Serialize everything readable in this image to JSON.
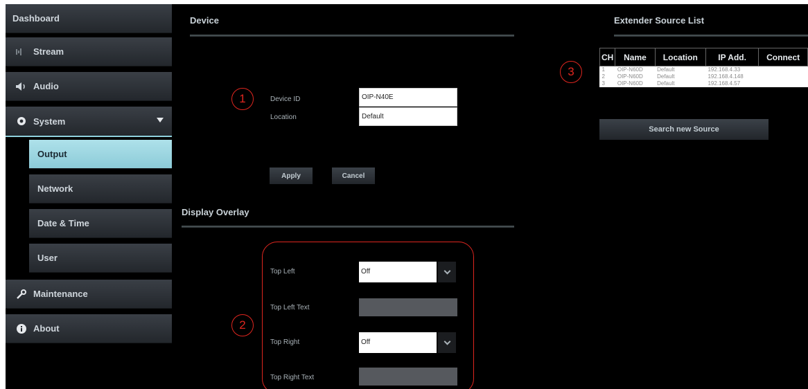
{
  "sidebar": {
    "dashboard": "Dashboard",
    "stream": "Stream",
    "audio": "Audio",
    "system": "System",
    "sub_items": [
      "Output",
      "Network",
      "Date & Time",
      "User"
    ],
    "maintenance": "Maintenance",
    "about": "About"
  },
  "device": {
    "title": "Device",
    "device_id_label": "Device ID",
    "device_id_value": "OIP-N40E",
    "location_label": "Location",
    "location_value": "Default",
    "apply_label": "Apply",
    "cancel_label": "Cancel"
  },
  "overlay": {
    "title": "Display Overlay",
    "top_left_label": "Top Left",
    "top_left_value": "Off",
    "top_left_text_label": "Top Left Text",
    "top_right_label": "Top Right",
    "top_right_value": "Off",
    "top_right_text_label": "Top Right Text"
  },
  "extender": {
    "title": "Extender Source List",
    "headers": [
      "CH",
      "Name",
      "Location",
      "IP Add.",
      "Connect"
    ],
    "rows": [
      [
        "1",
        "OIP-N60D",
        "Default",
        "192.168.4.33",
        ""
      ],
      [
        "2",
        "OIP-N60D",
        "Default",
        "192.168.4.148",
        ""
      ],
      [
        "3",
        "OIP-N60D",
        "Default",
        "192.168.4.57",
        ""
      ]
    ],
    "search_label": "Search new Source"
  },
  "callouts": [
    "1",
    "2",
    "3"
  ],
  "colors": {
    "active_item": "#9fd7e2",
    "callout_red": "#e0261f",
    "background": "#000000"
  }
}
